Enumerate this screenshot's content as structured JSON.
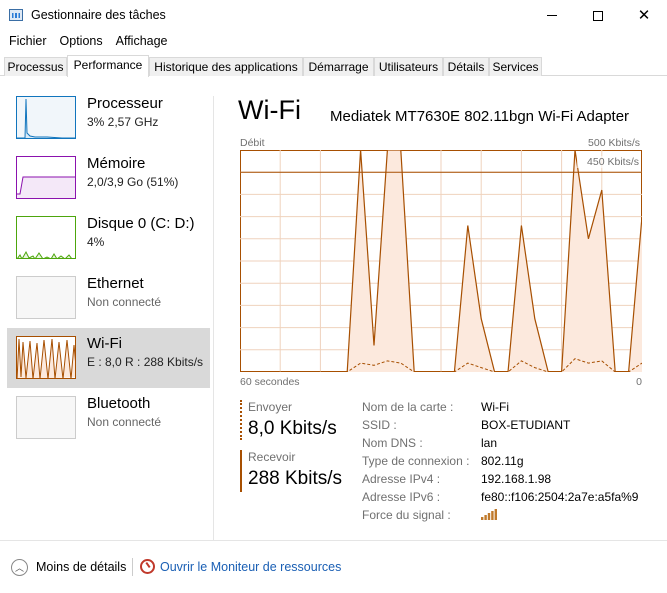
{
  "window": {
    "title": "Gestionnaire des tâches"
  },
  "menu": [
    "Fichier",
    "Options",
    "Affichage"
  ],
  "tabs": [
    "Processus",
    "Performance",
    "Historique des applications",
    "Démarrage",
    "Utilisateurs",
    "Détails",
    "Services"
  ],
  "active_tab": "Performance",
  "sidebar": [
    {
      "name": "Processeur",
      "detail": "3% 2,57 GHz",
      "color": "#1175bd"
    },
    {
      "name": "Mémoire",
      "detail": "2,0/3,9 Go (51%)",
      "color": "#8b12ae"
    },
    {
      "name": "Disque 0 (C: D:)",
      "detail": "4%",
      "color": "#4da60c"
    },
    {
      "name": "Ethernet",
      "detail": "Non connecté",
      "color": "#a74f01"
    },
    {
      "name": "Wi-Fi",
      "detail": "E : 8,0 R : 288 Kbits/s",
      "color": "#a74f01"
    },
    {
      "name": "Bluetooth",
      "detail": "Non connecté",
      "color": "#a74f01"
    }
  ],
  "selected_sidebar": "Wi-Fi",
  "main": {
    "title": "Wi-Fi",
    "adapter": "Mediatek MT7630E 802.11bgn Wi-Fi Adapter",
    "graph_label": "Débit",
    "graph_max": "500 Kbits/s",
    "graph_marker": "450 Kbits/s",
    "graph_time": "60 secondes",
    "graph_zero": "0",
    "send_label": "Envoyer",
    "send_value": "8,0 Kbits/s",
    "receive_label": "Recevoir",
    "receive_value": "288 Kbits/s",
    "properties": [
      {
        "key": "Nom de la carte :",
        "value": "Wi-Fi"
      },
      {
        "key": "SSID :",
        "value": "BOX-ETUDIANT"
      },
      {
        "key": "Nom DNS :",
        "value": "lan"
      },
      {
        "key": "Type de connexion :",
        "value": "802.11g"
      },
      {
        "key": "Adresse IPv4 :",
        "value": "192.168.1.98"
      },
      {
        "key": "Adresse IPv6 :",
        "value": "fe80::f106:2504:2a7e:a5fa%9"
      },
      {
        "key": "Force du signal :",
        "value": ""
      }
    ],
    "signal_bars": 5
  },
  "footer": {
    "fewer_details": "Moins de détails",
    "resource_monitor": "Ouvrir le Moniteur de ressources"
  },
  "chart_data": {
    "type": "area",
    "title": "Débit",
    "x_label": "60 secondes",
    "y_max_label": "500 Kbits/s",
    "ylim": [
      0,
      500
    ],
    "reference_line": 450,
    "x": [
      60,
      58,
      56,
      54,
      52,
      50,
      48,
      46,
      44,
      42,
      40,
      38,
      36,
      34,
      32,
      30,
      28,
      26,
      24,
      22,
      20,
      18,
      16,
      14,
      12,
      10,
      8,
      6,
      4,
      2,
      0
    ],
    "series": [
      {
        "name": "Recevoir",
        "values": [
          0,
          0,
          0,
          0,
          0,
          0,
          0,
          0,
          0,
          500,
          60,
          500,
          500,
          0,
          0,
          0,
          0,
          330,
          120,
          0,
          0,
          330,
          120,
          0,
          0,
          500,
          300,
          410,
          0,
          0,
          350
        ]
      },
      {
        "name": "Envoyer",
        "values": [
          0,
          0,
          0,
          0,
          0,
          0,
          0,
          0,
          0,
          20,
          15,
          25,
          20,
          0,
          0,
          0,
          0,
          20,
          10,
          0,
          0,
          25,
          10,
          0,
          0,
          30,
          20,
          25,
          0,
          0,
          20
        ]
      }
    ],
    "grid": true,
    "colors": {
      "line": "#a74f01",
      "fill": "#fce9dd",
      "grid": "#efd2bd"
    }
  }
}
